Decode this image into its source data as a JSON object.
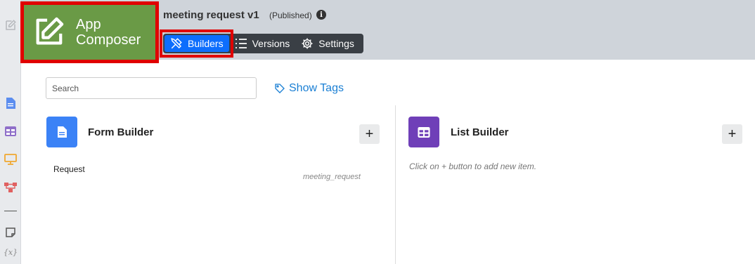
{
  "brand": {
    "title": "App\nComposer",
    "color": "#6a9a46",
    "icon": "edit-square-icon"
  },
  "app": {
    "name": "meeting request v1",
    "status": "(Published)"
  },
  "tabs": [
    {
      "label": "Builders",
      "icon": "tools-icon",
      "active": true
    },
    {
      "label": "Versions",
      "icon": "list-icon",
      "active": false
    },
    {
      "label": "Settings",
      "icon": "gear-icon",
      "active": false
    }
  ],
  "toolbar": {
    "search_placeholder": "Search",
    "show_tags_label": "Show Tags"
  },
  "builders": {
    "form": {
      "title": "Form Builder",
      "icon_color": "#3b82f6",
      "items": [
        {
          "name": "Request",
          "key": "meeting_request"
        }
      ]
    },
    "list": {
      "title": "List Builder",
      "icon_color": "#6f3fb8",
      "empty_hint": "Click on + button to add new item."
    }
  },
  "rail": {
    "vars_label": "{x}"
  },
  "colors": {
    "header_bg": "#cfd4da",
    "highlight_frame": "#e00000",
    "active_tab": "#0d6efd",
    "link": "#1a7fd4"
  }
}
